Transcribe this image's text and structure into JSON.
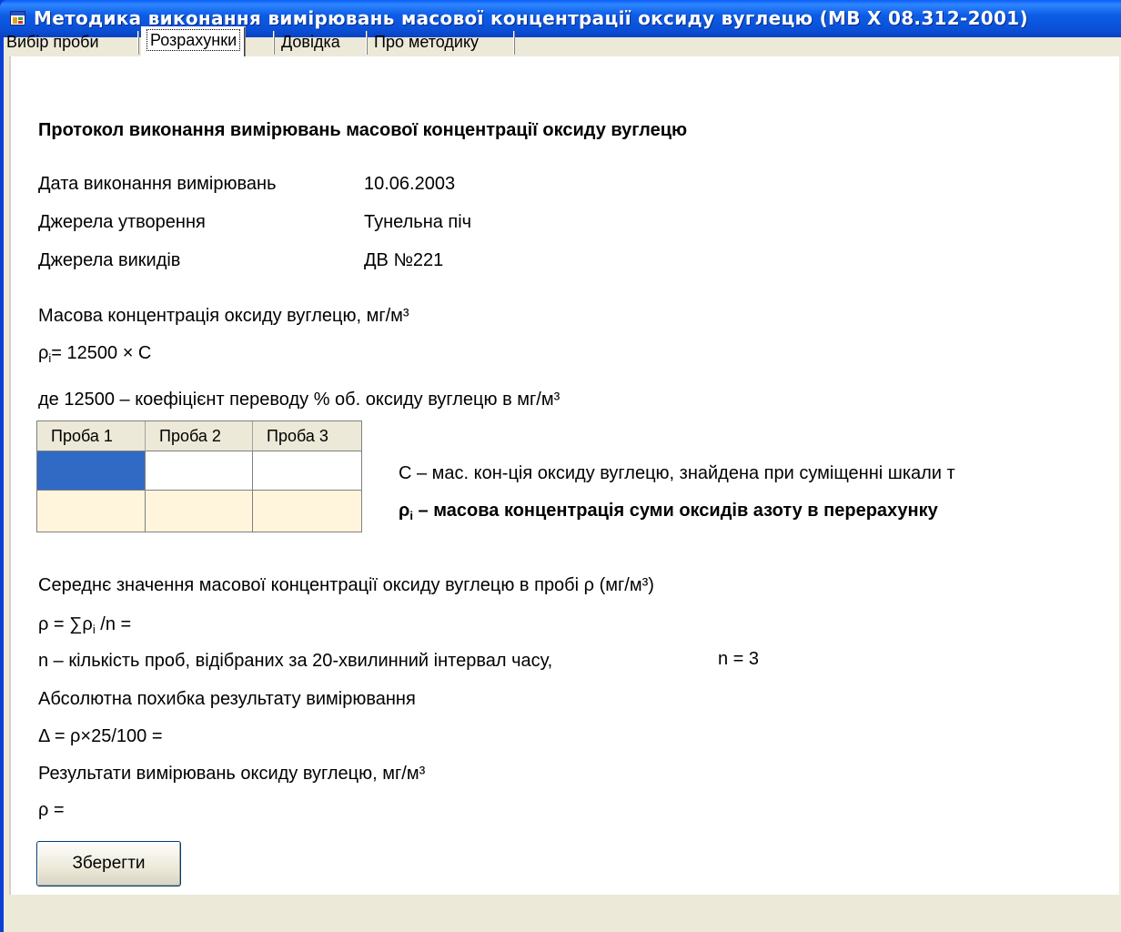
{
  "window": {
    "title": "Методика виконання вимірювань масової концентрації оксиду вуглецю (МВ Х 08.312-2001)"
  },
  "tabs": [
    {
      "label": "Вибір проби",
      "active": false
    },
    {
      "label": "Розрахунки",
      "active": true
    },
    {
      "label": "Довідка",
      "active": false
    },
    {
      "label": "Про методику",
      "active": false
    }
  ],
  "protocol": {
    "heading": "Протокол виконання вимірювань масової концентрації оксиду вуглецю",
    "date_label": "Дата виконання вимірювань",
    "date_value": "10.06.2003",
    "source_formation_label": "Джерела утворення",
    "source_formation_value": "Тунельна піч",
    "source_emission_label": "Джерела викидів",
    "source_emission_value": "ДВ №221",
    "mass_conc_label": "Масова концентрація оксиду вуглецю, мг/м³",
    "formula_rho_i_prefix": "ρ",
    "formula_rho_i_sub": "i",
    "formula_rho_i_rest": "= 12500 × С",
    "coef_note": "де 12500 – коефіцієнт переводу % об. оксиду вуглецю в мг/м³",
    "grid_headers": [
      "Проба 1",
      "Проба 2",
      "Проба 3"
    ],
    "legend_c": "С – мас. кон-ція оксиду вуглецю, знайдена при суміщенні шкали т",
    "legend_rho_prefix": "ρ",
    "legend_rho_sub": "i",
    "legend_rho_rest": " – масова концентрація суми оксидів азоту в перерахунку",
    "mean_label": "Середнє значення масової концентрації оксиду вуглецю в пробі ρ (мг/м³)",
    "mean_formula_prefix": "ρ = ∑ρ",
    "mean_formula_sub": "i",
    "mean_formula_rest": " /n =",
    "n_label": "n – кількість проб, відібраних за 20-хвилинний інтервал часу,",
    "n_value": "n = 3",
    "abs_error_label": "Абсолютна похибка результату вимірювання",
    "abs_error_formula": "Δ = ρ×25/100 =",
    "results_label": "Результати вимірювань оксиду вуглецю, мг/м³",
    "results_formula": "ρ ="
  },
  "save_button": "Зберегти"
}
